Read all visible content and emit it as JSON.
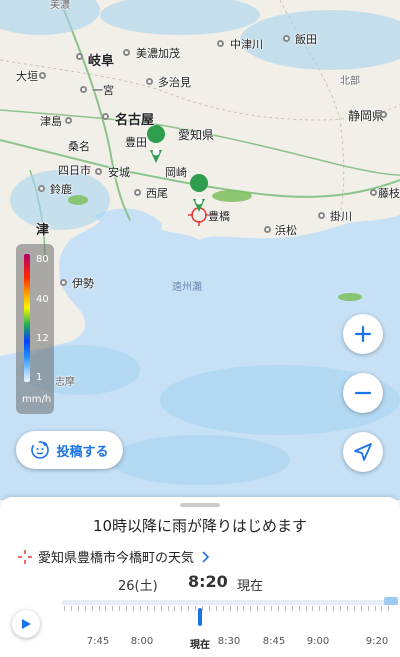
{
  "map": {
    "places": [
      {
        "name": "美濃"
      },
      {
        "name": "岐阜"
      },
      {
        "name": "美濃加茂"
      },
      {
        "name": "中津川"
      },
      {
        "name": "飯田"
      },
      {
        "name": "大垣"
      },
      {
        "name": "多治見"
      },
      {
        "name": "一宮"
      },
      {
        "name": "津島"
      },
      {
        "name": "名古屋"
      },
      {
        "name": "愛知県"
      },
      {
        "name": "静岡県"
      },
      {
        "name": "桑名"
      },
      {
        "name": "豊田"
      },
      {
        "name": "四日市"
      },
      {
        "name": "安城"
      },
      {
        "name": "岡崎"
      },
      {
        "name": "鈴鹿"
      },
      {
        "name": "西尾"
      },
      {
        "name": "豊橋"
      },
      {
        "name": "掛川"
      },
      {
        "name": "藤枝"
      },
      {
        "name": "浜松"
      },
      {
        "name": "津"
      },
      {
        "name": "伊勢"
      },
      {
        "name": "遠州灘"
      },
      {
        "name": "志摩"
      },
      {
        "name": "北部"
      }
    ]
  },
  "legend": {
    "labels": [
      "80",
      "40",
      "12",
      "1"
    ],
    "unit": "mm/h"
  },
  "buttons": {
    "post_label": "投稿する"
  },
  "sheet": {
    "headline": "10時以降に雨が降りはじめます",
    "location": "愛知県豊橋市今橋町の天気",
    "date": "26(土)",
    "time": "8:20",
    "status": "現在"
  },
  "timeline": {
    "ticks": [
      "7:45",
      "8:00",
      "現在",
      "8:30",
      "8:45",
      "9:00",
      "9:20"
    ],
    "current_index": 2
  },
  "colors": {
    "accent": "#1a73e8",
    "marker": "#2e9d4e",
    "sea": "#c6e0f6"
  }
}
